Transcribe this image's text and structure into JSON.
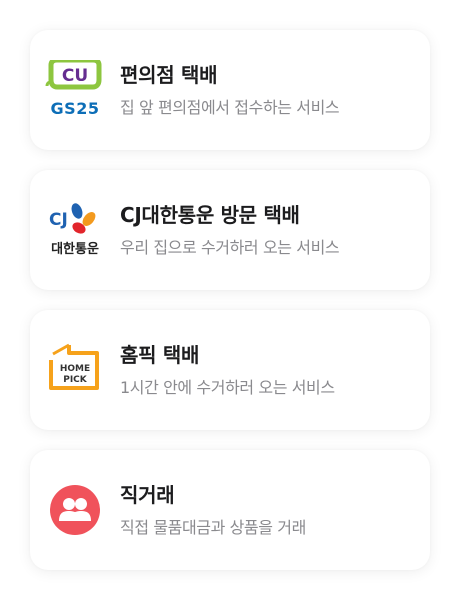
{
  "options": [
    {
      "id": "convenience",
      "icon": "cu-gs25-logo",
      "logo_text": [
        "CU",
        "GS25"
      ],
      "title": "편의점 택배",
      "description": "집 앞 편의점에서 접수하는 서비스"
    },
    {
      "id": "cj",
      "icon": "cj-logo",
      "logo_text": [
        "CJ",
        "대한통운"
      ],
      "title": "CJ대한통운 방문 택배",
      "description": "우리 집으로 수거하러 오는 서비스"
    },
    {
      "id": "homepick",
      "icon": "homepick-logo",
      "logo_text": [
        "HOME",
        "PICK"
      ],
      "title": "홈픽 택배",
      "description": "1시간 안에 수거하러 오는 서비스"
    },
    {
      "id": "direct",
      "icon": "people-icon",
      "title": "직거래",
      "description": "직접 물품대금과 상품을 거래"
    }
  ],
  "colors": {
    "cu_green": "#8dc63f",
    "cu_purple": "#652d90",
    "gs_blue": "#0d6eb7",
    "gs_cyan": "#1fb9e6",
    "cj_blue": "#1f62b1",
    "cj_red": "#e2252b",
    "cj_orange": "#f39a1e",
    "homepick_orange": "#f6a21b",
    "direct_red": "#f0525b"
  }
}
